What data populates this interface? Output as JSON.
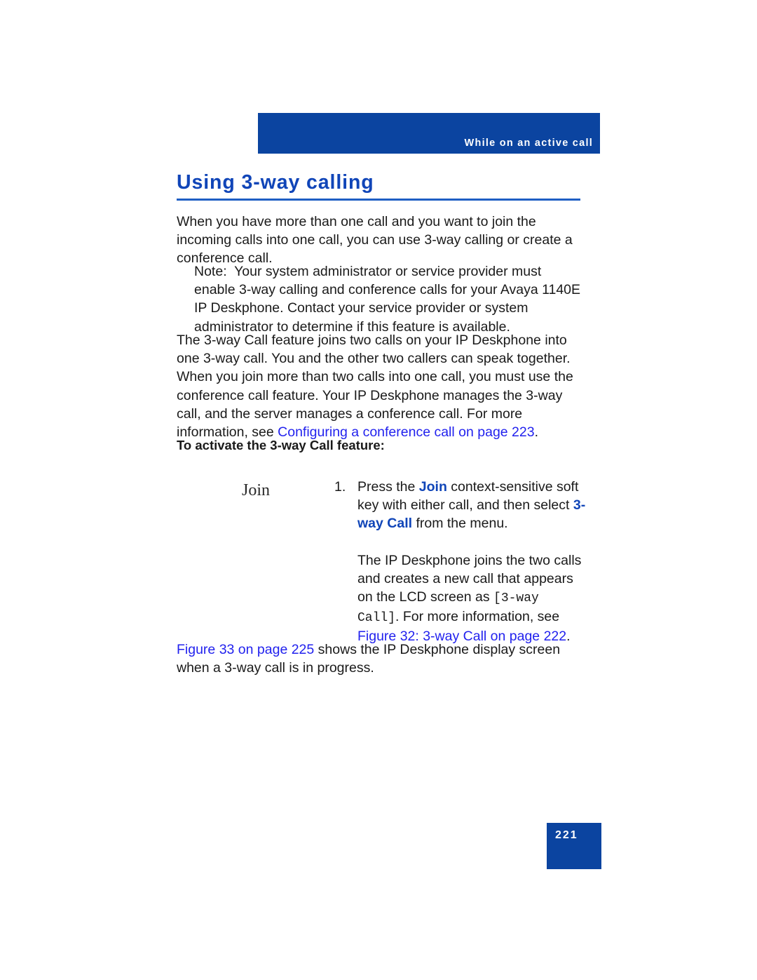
{
  "header": {
    "running_head": "While on an active call"
  },
  "title": {
    "text": "Using 3-way calling"
  },
  "paragraphs": {
    "intro": {
      "line1": "When you have more than one call and you want to join the incoming",
      "line2": "calls into one call, you can use 3-way calling or create a conference call."
    },
    "note": {
      "label": "Note:",
      "text": "Your system administrator or service provider must enable 3-way calling and conference calls for your Avaya 1140E IP Deskphone. Contact your service provider or system administrator to determine if this feature is available."
    },
    "main": {
      "text_before_link": "The 3-way Call feature joins two calls on your IP Deskphone into one 3-way call. You and the other two callers can speak together. When you join more than two calls into one call, you must use the conference call feature. Your IP Deskphone manages the 3-way call, and the server manages a conference call. For more information, see ",
      "link": "Configuring a conference call  on page 223",
      "text_after_link": "."
    },
    "closing": {
      "link": "Figure 33 on page 225",
      "text_after_link": " shows the IP Deskphone display screen when a 3-way call is in progress."
    }
  },
  "task": {
    "heading": "To activate the 3-way Call feature:",
    "softkey_label": "Join",
    "step": {
      "number": "1.",
      "para1": {
        "part1": "Press the ",
        "kw1": "Join",
        "part2": " context-sensitive soft key with either call, and then select ",
        "kw2": "3-way Call",
        "part3": " from the menu."
      },
      "para2": {
        "part1": "The IP Deskphone joins the two calls and creates a new call that appears on the LCD screen as ",
        "mono": "[3-way Call]",
        "part2": ". For more information, see ",
        "link": "Figure 32:  3-way Call  on page 222",
        "part3": "."
      }
    }
  },
  "footer": {
    "page_number": "221"
  },
  "colors": {
    "brand_blue": "#0b44a0",
    "heading_blue": "#1045b8",
    "link_blue": "#2222ee"
  }
}
